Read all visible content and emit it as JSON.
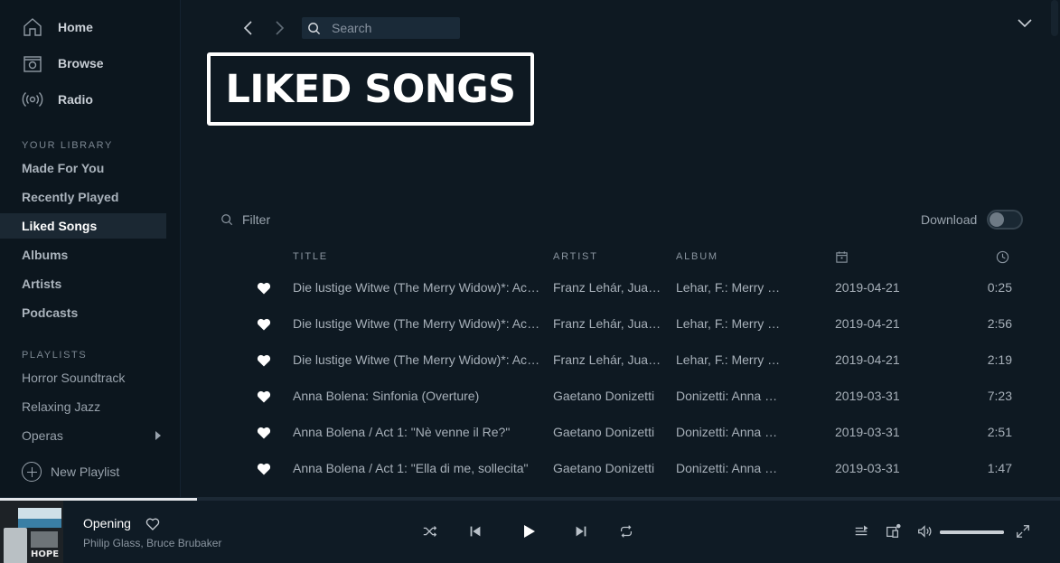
{
  "sidebar": {
    "nav": [
      {
        "label": "Home",
        "icon": "home-icon"
      },
      {
        "label": "Browse",
        "icon": "browse-icon"
      },
      {
        "label": "Radio",
        "icon": "radio-icon"
      }
    ],
    "library_heading": "YOUR LIBRARY",
    "library": [
      {
        "label": "Made For You",
        "active": false
      },
      {
        "label": "Recently Played",
        "active": false
      },
      {
        "label": "Liked Songs",
        "active": true
      },
      {
        "label": "Albums",
        "active": false
      },
      {
        "label": "Artists",
        "active": false
      },
      {
        "label": "Podcasts",
        "active": false
      }
    ],
    "playlists_heading": "PLAYLISTS",
    "playlists": [
      {
        "label": "Horror Soundtrack"
      },
      {
        "label": "Relaxing Jazz"
      },
      {
        "label": "Operas"
      }
    ],
    "new_playlist_label": "New Playlist"
  },
  "topbar": {
    "search_placeholder": "Search"
  },
  "page": {
    "title": "LIKED SONGS",
    "filter_placeholder": "Filter",
    "download_label": "Download",
    "download_enabled": false
  },
  "table": {
    "columns": {
      "title": "TITLE",
      "artist": "ARTIST",
      "album": "ALBUM",
      "date_icon": "calendar-icon",
      "duration_icon": "clock-icon"
    },
    "rows": [
      {
        "title": "Die lustige Witwe (The Merry Widow)*: Act I: Introduction",
        "artist": "Franz Lehár, Juan Diego",
        "album": "Lehar, F.: Merry Widow",
        "date": "2019-04-21",
        "duration": "0:25"
      },
      {
        "title": "Die lustige Witwe (The Merry Widow)*: Act I: Scene",
        "artist": "Franz Lehár, Juan Diego",
        "album": "Lehar, F.: Merry Widow",
        "date": "2019-04-21",
        "duration": "2:56"
      },
      {
        "title": "Die lustige Witwe (The Merry Widow)*: Act I: Duet",
        "artist": "Franz Lehár, Juan Diego",
        "album": "Lehar, F.: Merry Widow",
        "date": "2019-04-21",
        "duration": "2:19"
      },
      {
        "title": "Anna Bolena: Sinfonia (Overture)",
        "artist": "Gaetano Donizetti",
        "album": "Donizetti: Anna Bolena",
        "date": "2019-03-31",
        "duration": "7:23"
      },
      {
        "title": "Anna Bolena / Act 1: \"Nè venne il Re?\"",
        "artist": "Gaetano Donizetti",
        "album": "Donizetti: Anna Bolena",
        "date": "2019-03-31",
        "duration": "2:51"
      },
      {
        "title": "Anna Bolena / Act 1: \"Ella di me, sollecita\"",
        "artist": "Gaetano Donizetti",
        "album": "Donizetti: Anna Bolena",
        "date": "2019-03-31",
        "duration": "1:47"
      }
    ]
  },
  "player": {
    "track_title": "Opening",
    "track_artists": "Philip Glass, Bruce Brubaker",
    "cover_text": "HOPE",
    "progress_fraction": 0.186,
    "volume_fraction": 1.0
  },
  "colors": {
    "background": "#0e1922",
    "sidebar": "#0c161e",
    "accent_white": "#ffffff",
    "muted_text": "#a7b0b9"
  }
}
